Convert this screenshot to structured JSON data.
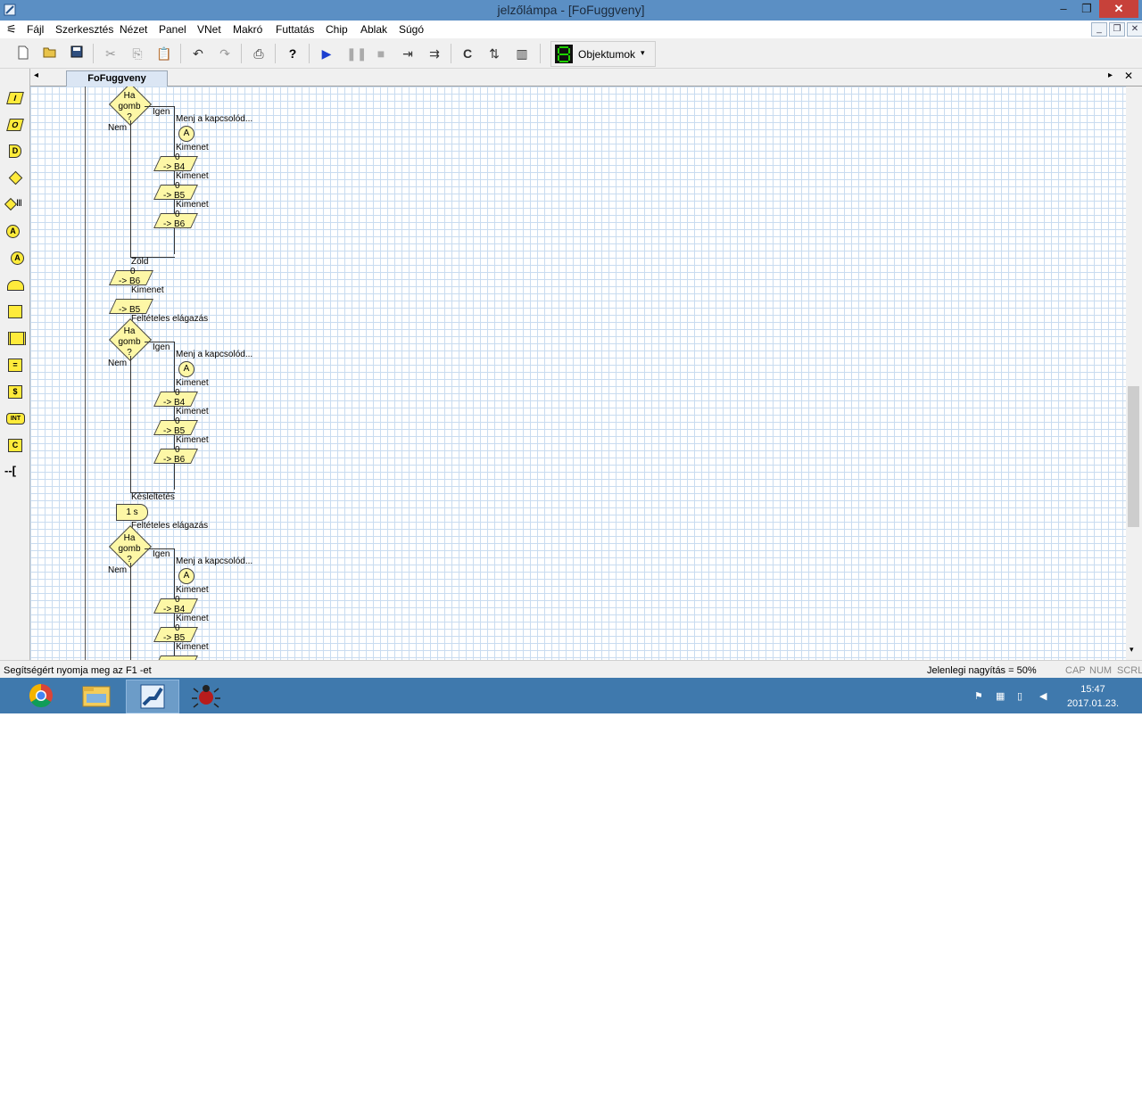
{
  "window": {
    "title": "jelzőlámpa - [FoFuggveny]",
    "minimize": "–",
    "maximize": "❐",
    "close": "✕"
  },
  "menu": {
    "items": [
      {
        "label": "Fájl"
      },
      {
        "label": "Szerkesztés"
      },
      {
        "label": "Nézet"
      },
      {
        "label": "Panel"
      },
      {
        "label": "VNet"
      },
      {
        "label": "Makró"
      },
      {
        "label": "Futtatás"
      },
      {
        "label": "Chip"
      },
      {
        "label": "Ablak"
      },
      {
        "label": "Súgó"
      }
    ],
    "mdi_min": "_",
    "mdi_restore": "❐",
    "mdi_close": "✕"
  },
  "toolbar": {
    "icons": [
      "new-icon",
      "open-icon",
      "save-icon",
      "cut-icon",
      "copy-icon",
      "paste-icon",
      "undo-icon",
      "redo-icon",
      "print-icon",
      "help-icon",
      "run-icon",
      "pause-icon",
      "stop-icon",
      "step-into-icon",
      "step-over-icon",
      "c-code-icon",
      "compile-icon",
      "chip-icon"
    ],
    "objects_label": "Objektumok",
    "objects_arrow": "▾"
  },
  "palette": {
    "items": [
      "I",
      "O",
      "D",
      "◆",
      "◆",
      "A",
      "A",
      "",
      "",
      "",
      "=",
      "$",
      "INT",
      "C",
      "["
    ]
  },
  "tabs": {
    "active": "FoFuggveny",
    "prev": "◂",
    "next": "▸",
    "close": "✕"
  },
  "flowchart": {
    "decision_text": [
      "Ha",
      "gomb",
      "?"
    ],
    "yes": "Igen",
    "no": "Nem",
    "goto_label": "Menj a kapcsolód...",
    "connector": "A",
    "output_label": "Kimenet",
    "output_value": "0",
    "ports": [
      "-> B4",
      "-> B5",
      "-> B6"
    ],
    "zold_label": "Zöld",
    "branch_label": "Feltételes elágazás",
    "delay_label": "Késleltetés",
    "delay_value": "1 s"
  },
  "status": {
    "help": "Segítségért nyomja meg az F1 -et",
    "zoom": "Jelenlegi nagyítás = 50%",
    "cap": "CAP",
    "num": "NUM",
    "scrl": "SCRL"
  },
  "taskbar": {
    "apps": [
      "chrome-icon",
      "file-explorer-icon",
      "flowcode-icon",
      "debugger-icon"
    ],
    "time": "15:47",
    "date": "2017.01.23."
  }
}
